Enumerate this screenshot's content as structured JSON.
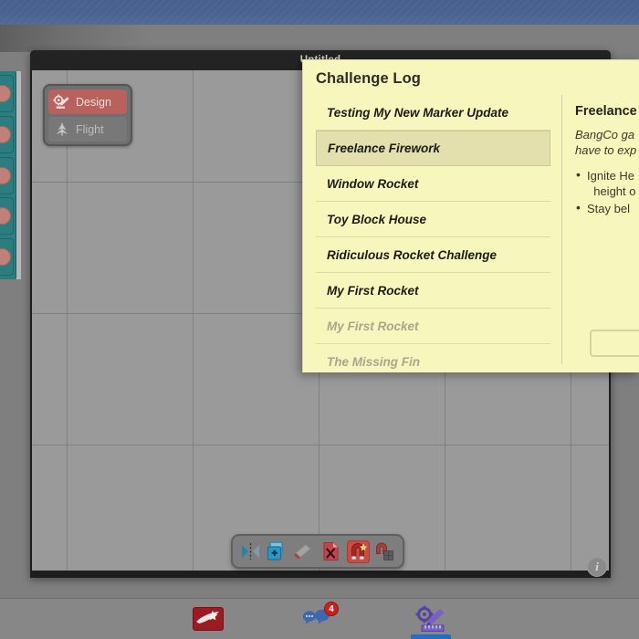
{
  "window": {
    "title": "Untitled"
  },
  "mode_switch": {
    "design_label": "Design",
    "flight_label": "Flight",
    "active": "Design",
    "active_color": "#b9615c",
    "idle_color": "#787878"
  },
  "toolbar": {
    "tools": [
      {
        "name": "mirror-symmetry-tool",
        "label": "Mirror",
        "active": false
      },
      {
        "name": "duplicate-part-tool",
        "label": "Duplicate",
        "active": false
      },
      {
        "name": "eraser-tool",
        "label": "Eraser",
        "active": false
      },
      {
        "name": "delete-design-tool",
        "label": "Delete",
        "active": false
      },
      {
        "name": "magnet-snap-tool",
        "label": "Snap",
        "active": true
      },
      {
        "name": "grid-snap-tool",
        "label": "Grid Snap",
        "active": false
      }
    ],
    "active_color": "#cc4b42"
  },
  "info_button": {
    "glyph": "i"
  },
  "bottom_nav": {
    "items": [
      {
        "name": "rockets-nav",
        "label": "Rockets",
        "badge": null,
        "selected": false
      },
      {
        "name": "messages-nav",
        "label": "Messages",
        "badge": "4",
        "selected": false
      },
      {
        "name": "design-nav",
        "label": "Design",
        "badge": null,
        "selected": true
      }
    ],
    "badge_color": "#c9211e",
    "selected_indicator_color": "#1f6fc4"
  },
  "dialog": {
    "title": "Challenge Log",
    "background": "#f7f6bd",
    "selected_background": "#e3e0ae",
    "challenges": [
      {
        "label": "Testing My New Marker Update",
        "state": "available"
      },
      {
        "label": "Freelance Firework",
        "state": "selected"
      },
      {
        "label": "Window Rocket",
        "state": "available"
      },
      {
        "label": "Toy Block House",
        "state": "available"
      },
      {
        "label": "Ridiculous Rocket Challenge",
        "state": "available"
      },
      {
        "label": "My First Rocket",
        "state": "available"
      },
      {
        "label": "My First Rocket",
        "state": "locked"
      },
      {
        "label": "The Missing Fin",
        "state": "locked"
      }
    ],
    "detail": {
      "title": "Freelance",
      "description": "BangCo ga\nhave to exp",
      "goals": [
        "Ignite He\n  height o",
        "Stay bel"
      ]
    }
  },
  "parts_palette": {
    "panel_color": "#2b7d80",
    "part_color": "#c08078",
    "slots": 5
  },
  "canvas": {
    "grid_color": "#787878",
    "background": "#9a9a9a"
  },
  "theme": {
    "top_band": "#4a6492",
    "desktop": "#7f7f7f",
    "window_chrome": "#232323"
  }
}
